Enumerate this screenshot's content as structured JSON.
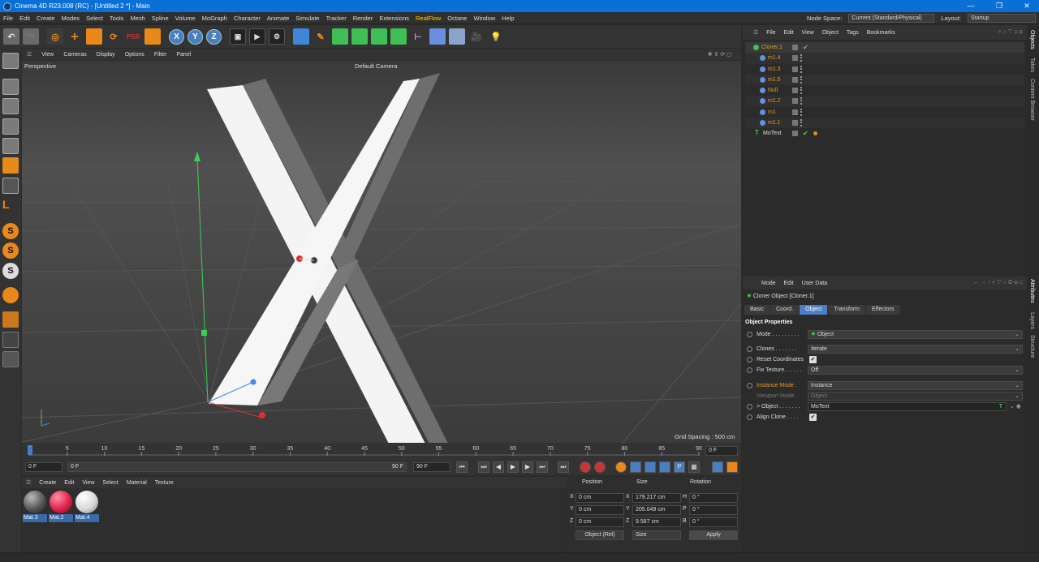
{
  "titlebar": {
    "title": "Cinema 4D R23.008 (RC) - [Untitled 2 *] - Main"
  },
  "menubar": {
    "items": [
      "File",
      "Edit",
      "Create",
      "Modes",
      "Select",
      "Tools",
      "Mesh",
      "Spline",
      "Volume",
      "MoGraph",
      "Character",
      "Animate",
      "Simulate",
      "Tracker",
      "Render",
      "Extensions",
      "RealFlow",
      "Octane",
      "Window",
      "Help"
    ],
    "node_space_label": "Node Space:",
    "node_space_value": "Current (Standard/Physical)",
    "layout_label": "Layout:",
    "layout_value": "Startup"
  },
  "toolbar": {
    "axis_x": "X",
    "axis_y": "Y",
    "axis_z": "Z"
  },
  "viewport": {
    "menu": [
      "View",
      "Cameras",
      "Display",
      "Options",
      "Filter",
      "Panel"
    ],
    "projection": "Perspective",
    "camera": "Default Camera",
    "grid_spacing": "Grid Spacing : 500 cm",
    "axis_labels": {
      "y": "Y",
      "x": "X",
      "z": "Z"
    }
  },
  "timeline": {
    "ticks": [
      "0",
      "5",
      "10",
      "15",
      "20",
      "25",
      "30",
      "35",
      "40",
      "45",
      "50",
      "55",
      "60",
      "65",
      "70",
      "75",
      "80",
      "85",
      "90"
    ],
    "current_frame": "0 F"
  },
  "transport": {
    "start_field": "0 F",
    "range_start": "0 F",
    "range_end": "90 F",
    "end_field": "90 F"
  },
  "material_manager": {
    "menu": [
      "Create",
      "Edit",
      "View",
      "Select",
      "Material",
      "Texture"
    ],
    "materials": [
      {
        "name": "Mat.3",
        "color": "#555555"
      },
      {
        "name": "Mat.2",
        "color": "#e0224a"
      },
      {
        "name": "Mat.4",
        "color": "#d8d8d8"
      }
    ]
  },
  "coordinate_manager": {
    "headers": {
      "position": "Position",
      "size": "Size",
      "rotation": "Rotation"
    },
    "rows": [
      {
        "axis": "X",
        "pos": "0 cm",
        "size_axis": "X",
        "size": "179.217 cm",
        "rot_axis": "H",
        "rot": "0 °"
      },
      {
        "axis": "Y",
        "pos": "0 cm",
        "size_axis": "Y",
        "size": "205.049 cm",
        "rot_axis": "P",
        "rot": "0 °"
      },
      {
        "axis": "Z",
        "pos": "0 cm",
        "size_axis": "Z",
        "size": "9.587 cm",
        "rot_axis": "B",
        "rot": "0 °"
      }
    ],
    "mode_select": "Object (Rel)",
    "size_select": "Size",
    "apply_label": "Apply"
  },
  "object_manager": {
    "menu": [
      "File",
      "Edit",
      "View",
      "Object",
      "Tags",
      "Bookmarks"
    ],
    "objects": [
      {
        "name": "Cloner.1",
        "color": "orange",
        "indent": 0,
        "check": true
      },
      {
        "name": "m1.4",
        "color": "orange",
        "indent": 1,
        "check": false
      },
      {
        "name": "m1.3",
        "color": "orange",
        "indent": 1,
        "check": false
      },
      {
        "name": "m1.5",
        "color": "orange",
        "indent": 1,
        "check": false
      },
      {
        "name": "Null",
        "color": "orange",
        "indent": 1,
        "check": false
      },
      {
        "name": "m1.2",
        "color": "orange",
        "indent": 1,
        "check": false
      },
      {
        "name": "m1",
        "color": "orange",
        "indent": 1,
        "check": false
      },
      {
        "name": "m1.1",
        "color": "orange",
        "indent": 1,
        "check": false
      },
      {
        "name": "MoText",
        "color": "white",
        "indent": 0,
        "check": true
      }
    ]
  },
  "attributes": {
    "menu": [
      "Mode",
      "Edit",
      "User Data"
    ],
    "object_title": "Cloner Object [Cloner.1]",
    "tabs": [
      "Basic",
      "Coord.",
      "Object",
      "Transform",
      "Effectors"
    ],
    "active_tab": "Object",
    "section": "Object Properties",
    "props": {
      "mode_label": "Mode . . . . . . . . .",
      "mode_value": "Object",
      "clones_label": "Clones . . . . . . .",
      "clones_value": "Iterate",
      "reset_label": "Reset Coordinates",
      "fix_label": "Fix Texture. . . . . .",
      "fix_value": "Off",
      "instance_label": "Instance Mode .",
      "instance_value": "Instance",
      "viewport_label": "Viewport Mode .",
      "viewport_value": "Object",
      "object_label": "> Object . . . . . . .",
      "object_value": "MoText",
      "align_label": "Align Clone . . . ."
    }
  },
  "side_tabs": [
    "Objects",
    "Takes",
    "Content Browser",
    "Attributes",
    "Layers",
    "Structure"
  ]
}
